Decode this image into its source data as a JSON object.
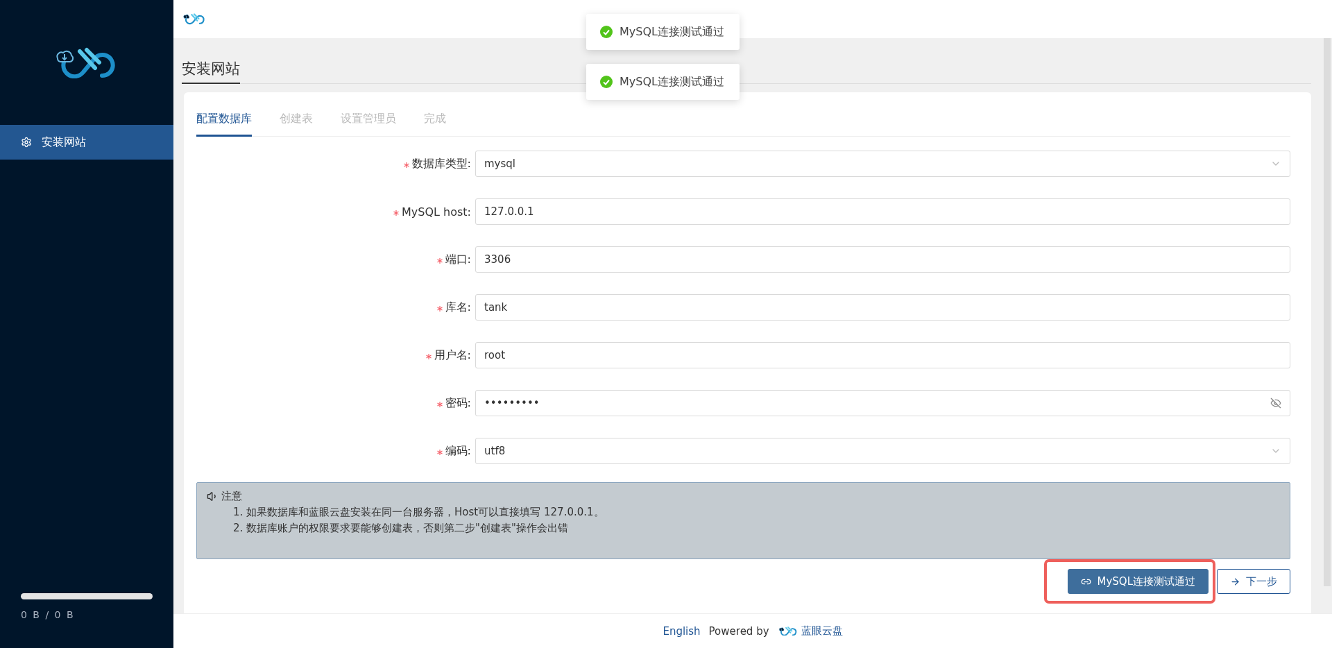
{
  "sidebar": {
    "menu": [
      {
        "label": "安装网站",
        "selected": true
      }
    ],
    "usage": "0 B / 0 B"
  },
  "page_title": "安装网站",
  "steps": [
    {
      "label": "配置数据库",
      "selected": true
    },
    {
      "label": "创建表",
      "selected": false
    },
    {
      "label": "设置管理员",
      "selected": false
    },
    {
      "label": "完成",
      "selected": false
    }
  ],
  "fields": [
    {
      "kind": "select",
      "label": "数据库类型:",
      "required": true,
      "value": "mysql"
    },
    {
      "kind": "text",
      "label": "MySQL host:",
      "required": true,
      "value": "127.0.0.1"
    },
    {
      "kind": "text",
      "label": "端口:",
      "required": true,
      "value": "3306"
    },
    {
      "kind": "text",
      "label": "库名:",
      "required": true,
      "value": "tank"
    },
    {
      "kind": "text",
      "label": "用户名:",
      "required": true,
      "value": "root"
    },
    {
      "kind": "password",
      "label": "密码:",
      "required": true,
      "value": "•••••••••"
    },
    {
      "kind": "select",
      "label": "编码:",
      "required": true,
      "value": "utf8"
    }
  ],
  "notice": {
    "title": "注意",
    "items": [
      "1. 如果数据库和蓝眼云盘安装在同一台服务器，Host可以直接填写 127.0.0.1。",
      "2. 数据库账户的权限要求要能够创建表，否则第二步\"创建表\"操作会出错"
    ]
  },
  "buttons": [
    {
      "kind": "primary",
      "label": "MySQL连接测试通过",
      "highlighted": true
    },
    {
      "kind": "default",
      "label": "下一步",
      "highlighted": false
    }
  ],
  "toasts": [
    {
      "text": "MySQL连接测试通过"
    },
    {
      "text": "MySQL连接测试通过"
    }
  ],
  "footer": {
    "language": "English",
    "powered": "Powered by",
    "brand": "蓝眼云盘"
  }
}
